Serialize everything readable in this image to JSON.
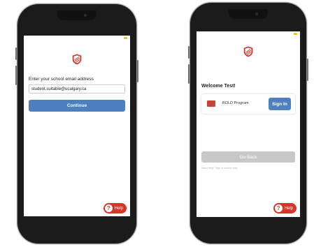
{
  "colors": {
    "primary_blue": "#4e7fbf",
    "brand_red": "#d7342a",
    "disabled_gray": "#c8c8c8",
    "phone_body": "#1b1b1b",
    "status_yellow": "#f5c400"
  },
  "left_screen": {
    "logo_icon": "shield-icon",
    "email_prompt": "Enter your school email address",
    "email_value": "student.suitable@ucalgary.ca",
    "continue_label": "Continue",
    "help_label": "Help",
    "help_icon": "question-icon"
  },
  "right_screen": {
    "logo_icon": "shield-icon",
    "welcome_text": "Welcome Test!",
    "program_name": "BOLD Program",
    "sign_in_label": "Sign In",
    "go_back_label": "Go Back",
    "hint_text": "Need Help? Sign in another way",
    "help_label": "Help",
    "help_icon": "question-icon"
  }
}
